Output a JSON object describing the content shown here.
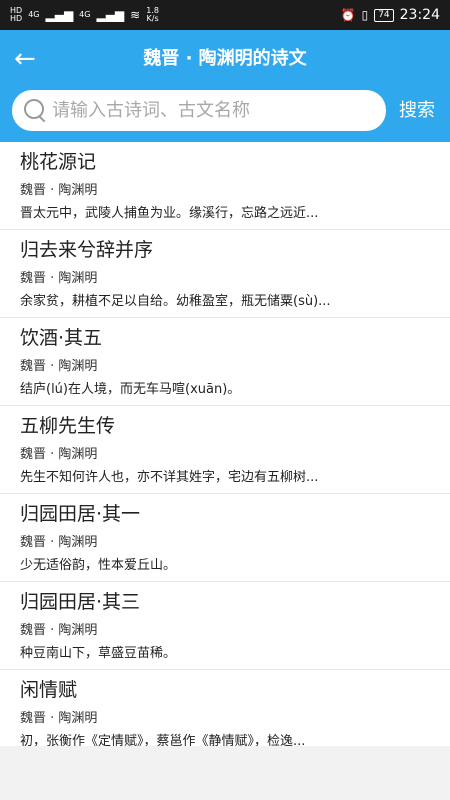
{
  "status_bar": {
    "left_hd1": "HD",
    "left_hd2": "HD",
    "net1": "4G",
    "net2": "4G",
    "speed": "1.8",
    "speed_unit": "K/s",
    "battery": "74",
    "time": "23:24"
  },
  "header": {
    "back_glyph": "←",
    "title": "魏晋 · 陶渊明的诗文"
  },
  "search": {
    "placeholder": "请输入古诗词、古文名称",
    "button_label": "搜索"
  },
  "poems": [
    {
      "title": "桃花源记",
      "author": "魏晋 · 陶渊明",
      "excerpt": "晋太元中，武陵人捕鱼为业。缘溪行，忘路之远近..."
    },
    {
      "title": "归去来兮辞并序",
      "author": "魏晋 · 陶渊明",
      "excerpt": "余家贫，耕植不足以自给。幼稚盈室，瓶无储粟(sù)..."
    },
    {
      "title": "饮酒·其五",
      "author": "魏晋 · 陶渊明",
      "excerpt": "结庐(lú)在人境，而无车马喧(xuān)。"
    },
    {
      "title": "五柳先生传",
      "author": "魏晋 · 陶渊明",
      "excerpt": "先生不知何许人也，亦不详其姓字，宅边有五柳树..."
    },
    {
      "title": "归园田居·其一",
      "author": "魏晋 · 陶渊明",
      "excerpt": "少无适俗韵，性本爱丘山。"
    },
    {
      "title": "归园田居·其三",
      "author": "魏晋 · 陶渊明",
      "excerpt": "种豆南山下，草盛豆苗稀。"
    },
    {
      "title": "闲情赋",
      "author": "魏晋 · 陶渊明",
      "excerpt": "初，张衡作《定情赋》，蔡邕作《静情赋》，检逸..."
    }
  ]
}
